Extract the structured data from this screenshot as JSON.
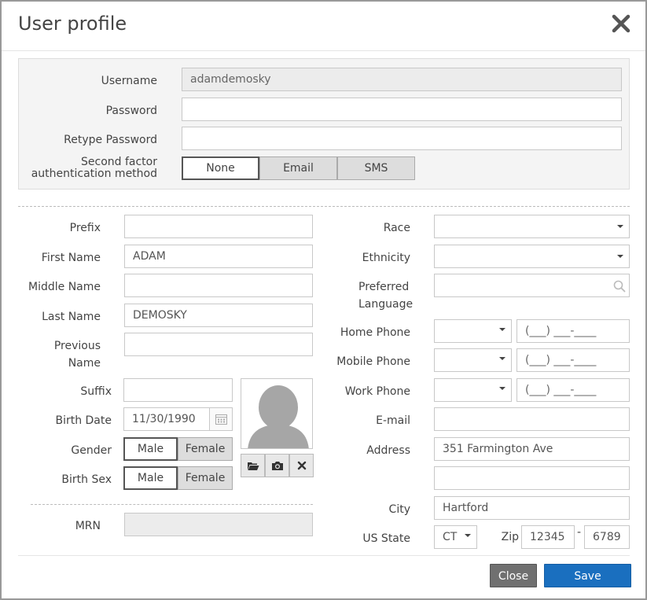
{
  "dialog": {
    "title": "User profile",
    "close_icon": "close-icon"
  },
  "account": {
    "username_label": "Username",
    "username_value": "adamdemosky",
    "password_label": "Password",
    "password_value": "",
    "retype_label": "Retype Password",
    "retype_value": "",
    "twofactor_label_line1": "Second factor",
    "twofactor_label_line2": "authentication method",
    "twofactor_options": [
      "None",
      "Email",
      "SMS"
    ],
    "twofactor_selected": "None"
  },
  "left": {
    "prefix_label": "Prefix",
    "prefix_value": "",
    "first_name_label": "First Name",
    "first_name_value": "ADAM",
    "middle_name_label": "Middle Name",
    "middle_name_value": "",
    "last_name_label": "Last Name",
    "last_name_value": "DEMOSKY",
    "previous_name_label_line1": "Previous",
    "previous_name_label_line2": "Name",
    "previous_name_value": "",
    "suffix_label": "Suffix",
    "suffix_value": "",
    "birth_date_label": "Birth Date",
    "birth_date_value": "11/30/1990",
    "gender_label": "Gender",
    "gender_options": [
      "Male",
      "Female"
    ],
    "gender_selected": "Male",
    "birth_sex_label": "Birth Sex",
    "birth_sex_options": [
      "Male",
      "Female"
    ],
    "birth_sex_selected": "Male",
    "mrn_label": "MRN",
    "mrn_value": ""
  },
  "right": {
    "race_label": "Race",
    "race_value": "",
    "ethnicity_label": "Ethnicity",
    "ethnicity_value": "",
    "preferred_language_label_line1": "Preferred",
    "preferred_language_label_line2": "Language",
    "preferred_language_value": "",
    "home_phone_label": "Home Phone",
    "mobile_phone_label": "Mobile Phone",
    "work_phone_label": "Work Phone",
    "phone_mask": "(___) ___-____",
    "email_label": "E-mail",
    "email_value": "",
    "address_label": "Address",
    "address_line1": "351 Farmington Ave",
    "address_line2": "",
    "city_label": "City",
    "city_value": "Hartford",
    "state_label": "US State",
    "state_value": "CT",
    "zip_label": "Zip",
    "zip_value": "12345",
    "zip_separator": "-",
    "zip_ext_value": "6789"
  },
  "footer": {
    "close_label": "Close",
    "save_label": "Save"
  },
  "colors": {
    "primary": "#1a6fbf",
    "secondary": "#707070"
  }
}
